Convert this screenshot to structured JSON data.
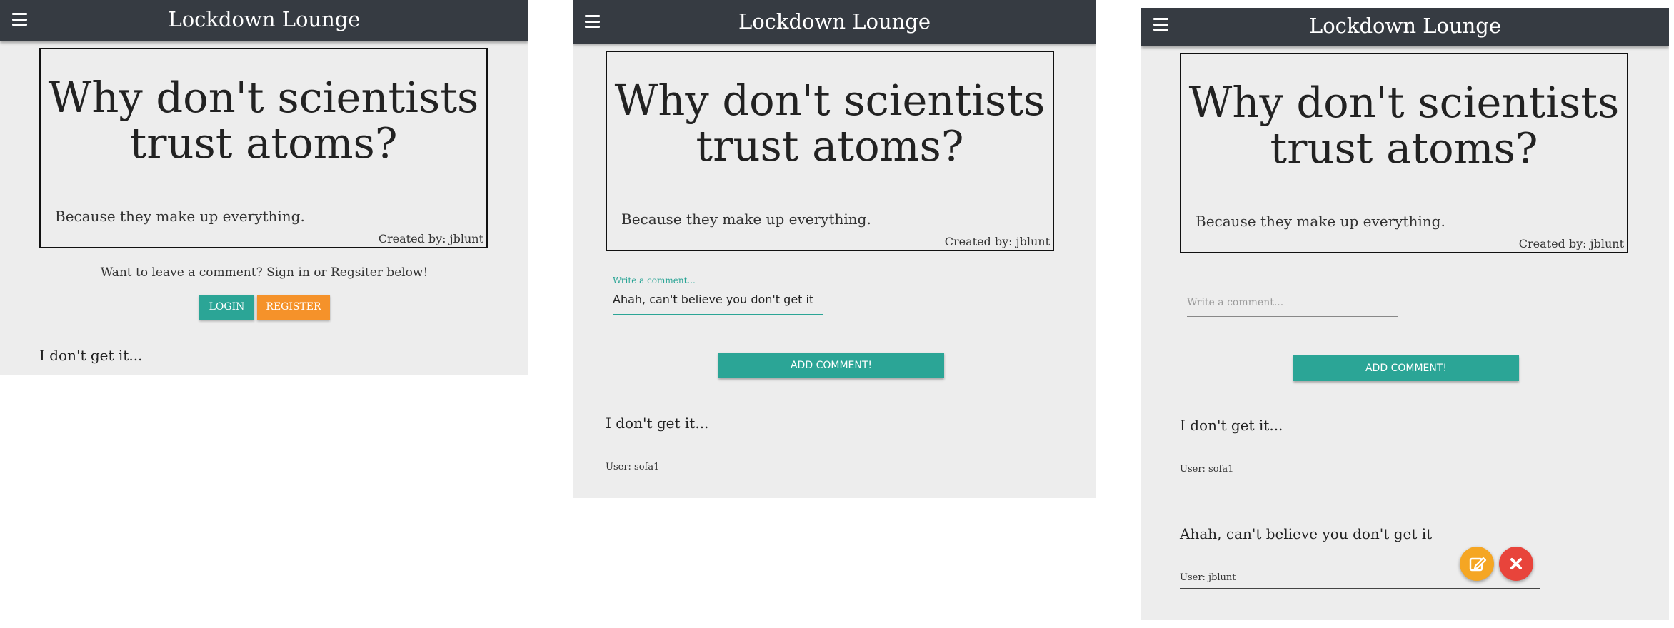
{
  "app": {
    "title": "Lockdown Lounge"
  },
  "joke": {
    "title_line1": "Why don't scientists",
    "title_line2": "trust atoms?",
    "punchline": "Because they make up everything.",
    "created_by": "Created by: jblunt"
  },
  "panel1": {
    "signin_prompt": "Want to leave a comment? Sign in or Regsiter below!",
    "login_label": "LOGIN",
    "register_label": "REGISTER",
    "comments": [
      {
        "text": "I don't get it..."
      }
    ]
  },
  "panel2": {
    "comment_label": "Write a comment...",
    "comment_value": "Ahah, can't believe you don't get it",
    "add_label": "ADD COMMENT!",
    "comments": [
      {
        "text": "I don't get it...",
        "user": "User: sofa1"
      }
    ]
  },
  "panel3": {
    "comment_placeholder": "Write a comment...",
    "add_label": "ADD COMMENT!",
    "comments": [
      {
        "text": "I don't get it...",
        "user": "User: sofa1"
      },
      {
        "text": "Ahah, can't believe you don't get it",
        "user": "User: jblunt"
      }
    ]
  },
  "colors": {
    "navbar": "#363b42",
    "teal": "#2ba596",
    "orange": "#f5922a",
    "red": "#e8443b",
    "background": "#ededed"
  },
  "icons": {
    "menu": "menu-icon",
    "edit": "edit-icon",
    "delete": "close-icon"
  }
}
